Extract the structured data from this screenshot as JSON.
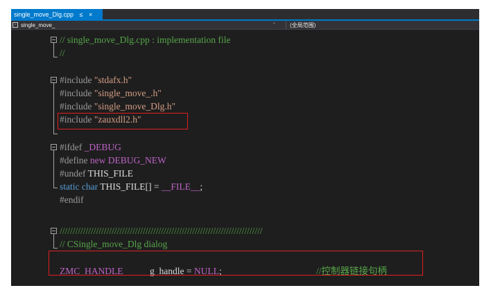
{
  "tab": {
    "title": "single_move_Dlg.cpp",
    "pin": "≤",
    "close": "×"
  },
  "nav": {
    "project": "single_move_",
    "dropdown": "ˇ",
    "scope": "(全局范围)"
  },
  "colors": {
    "comment": "#57a64a",
    "preprocessor": "#9b9b9b",
    "string": "#d69d85",
    "keyword": "#569cd6",
    "macro": "#bd63c5",
    "text": "#dcdcdc",
    "accent": "#007acc",
    "highlight_box": "#e02020"
  },
  "code": {
    "l1": "// single_move_Dlg.cpp : implementation file",
    "l2": "//",
    "inc1_kw": "#include ",
    "inc1_str": "\"stdafx.h\"",
    "inc2_kw": "#include ",
    "inc2_str": "\"single_move_.h\"",
    "inc3_kw": "#include ",
    "inc3_str": "\"single_move_Dlg.h\"",
    "inc4_kw": "#include ",
    "inc4_str": "\"zauxdll2.h\"",
    "ifdef_kw": "#ifdef ",
    "ifdef_mac": "_DEBUG",
    "define_kw": "#define ",
    "define_new": "new ",
    "define_mac": "DEBUG_NEW",
    "undef_kw": "#undef ",
    "undef_id": "THIS_FILE",
    "static_kw": "static ",
    "char_kw": "char ",
    "static_rest": "THIS_FILE[] = ",
    "file_mac": "__FILE__",
    "semi": ";",
    "endif": "#endif",
    "slashes": "//////////////////////////////////////////////////////////////////////////////",
    "cdlg": "// CSingle_move_Dlg dialog",
    "zmc_type": "ZMC_HANDLE",
    "zmc_var": "g_handle = ",
    "zmc_null": "NULL",
    "zmc_semi": ";",
    "zmc_cmt": "//控制器链接句柄"
  }
}
